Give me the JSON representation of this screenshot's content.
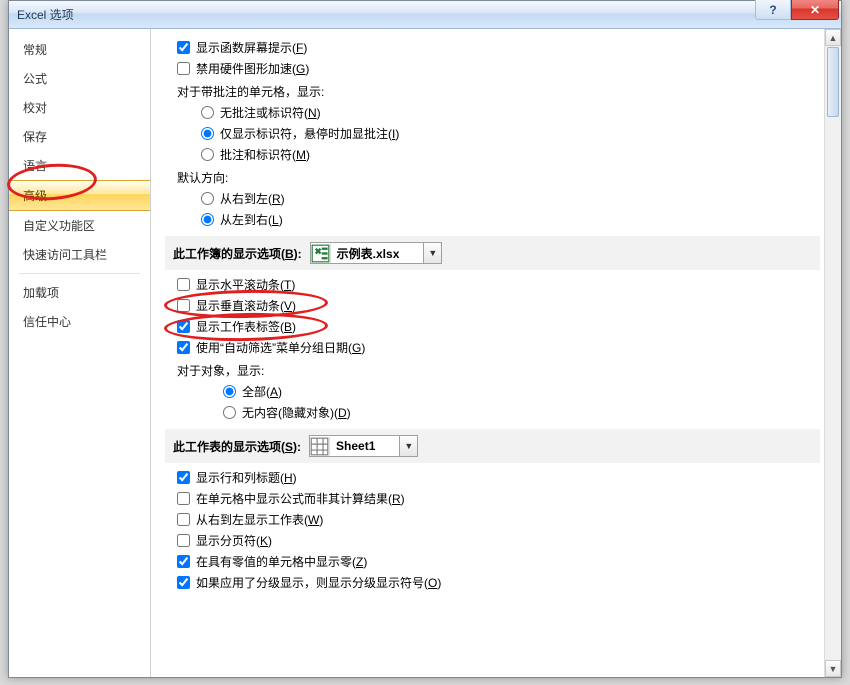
{
  "title": "Excel 选项",
  "titlebar": {
    "help": "?",
    "close": "✕"
  },
  "nav": {
    "items": [
      {
        "label": "常规"
      },
      {
        "label": "公式"
      },
      {
        "label": "校对"
      },
      {
        "label": "保存"
      },
      {
        "label": "语言"
      },
      {
        "label": "高级",
        "selected": true
      },
      {
        "label": "自定义功能区"
      },
      {
        "label": "快速访问工具栏"
      },
      {
        "label": "加载项"
      },
      {
        "label": "信任中心"
      }
    ]
  },
  "opts": {
    "show_func_tooltip": {
      "text": "显示函数屏幕提示(",
      "mn": "F",
      "tail": ")"
    },
    "disable_hw_accel": {
      "text": "禁用硬件图形加速(",
      "mn": "G",
      "tail": ")"
    },
    "comment_header": "对于带批注的单元格，显示:",
    "comment_none": {
      "text": "无批注或标识符(",
      "mn": "N",
      "tail": ")"
    },
    "comment_ind": {
      "text": "仅显示标识符，悬停时加显批注(",
      "mn": "I",
      "tail": ")"
    },
    "comment_both": {
      "text": "批注和标识符(",
      "mn": "M",
      "tail": ")"
    },
    "default_dir": "默认方向:",
    "dir_rtl": {
      "text": "从右到左(",
      "mn": "R",
      "tail": ")"
    },
    "dir_ltr": {
      "text": "从左到右(",
      "mn": "L",
      "tail": ")"
    },
    "wb_section": {
      "text": "此工作簿的显示选项(",
      "mn": "B",
      "tail": "):",
      "value": "示例表.xlsx"
    },
    "hscroll": {
      "text": "显示水平滚动条(",
      "mn": "T",
      "tail": ")"
    },
    "vscroll": {
      "text": "显示垂直滚动条(",
      "mn": "V",
      "tail": ")"
    },
    "sheet_tabs": {
      "text": "显示工作表标签(",
      "mn": "B",
      "tail": ")"
    },
    "autofilter_group": {
      "text": "使用“自动筛选”菜单分组日期(",
      "mn": "G",
      "tail": ")"
    },
    "objects_header": "对于对象，显示:",
    "obj_all": {
      "text": "全部(",
      "mn": "A",
      "tail": ")"
    },
    "obj_none": {
      "text": "无内容(隐藏对象)(",
      "mn": "D",
      "tail": ")"
    },
    "ws_section": {
      "text": "此工作表的显示选项(",
      "mn": "S",
      "tail": "):",
      "value": "Sheet1"
    },
    "rowcol_headers": {
      "text": "显示行和列标题(",
      "mn": "H",
      "tail": ")"
    },
    "show_formulas": {
      "text": "在单元格中显示公式而非其计算结果(",
      "mn": "R",
      "tail": ")"
    },
    "rtl_sheet": {
      "text": "从右到左显示工作表(",
      "mn": "W",
      "tail": ")"
    },
    "page_breaks": {
      "text": "显示分页符(",
      "mn": "K",
      "tail": ")"
    },
    "show_zero": {
      "text": "在具有零值的单元格中显示零(",
      "mn": "Z",
      "tail": ")"
    },
    "outline_symbols": {
      "text": "如果应用了分级显示，则显示分级显示符号(",
      "mn": "O",
      "tail": ")"
    }
  }
}
